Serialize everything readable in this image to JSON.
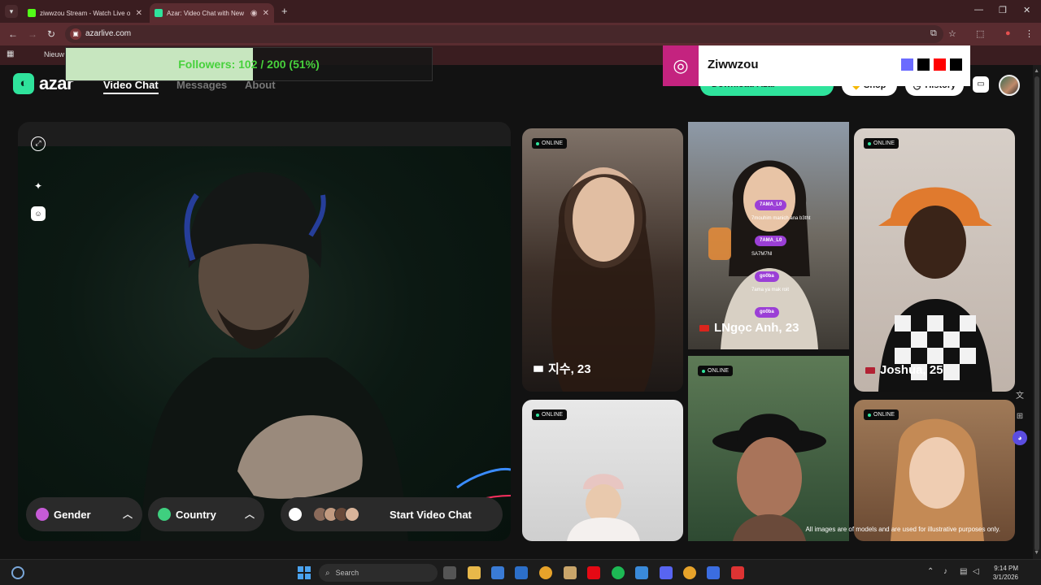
{
  "browser": {
    "tabs": [
      {
        "title": "ziwwzou Stream - Watch Live o",
        "favicon_color": "#53fc18"
      },
      {
        "title": "Azar: Video Chat with New",
        "favicon_color": "#2fe39c"
      }
    ],
    "new_tab": "+",
    "address": "azarlive.com",
    "bookmark": "Nieuw"
  },
  "overlay": {
    "followers_text": "Followers: 102 / 200 (51%)",
    "followers_progress": 0.51,
    "instagram_name": "Ziwwzou",
    "swatches": [
      "#6b6bff",
      "#000000",
      "#ff0000",
      "#000000"
    ]
  },
  "site": {
    "logo_text": "azar",
    "nav": [
      "Video Chat",
      "Messages",
      "About"
    ],
    "green_button": "Download Azar",
    "shop": "Shop",
    "history": "History"
  },
  "camera": {
    "filters": [
      {
        "label": "Gender",
        "icon": "gender-icon"
      },
      {
        "label": "Country",
        "icon": "globe-icon"
      }
    ],
    "start_label": "Start Video Chat"
  },
  "gallery": {
    "online_label": "ONLINE",
    "cards": [
      {
        "name": "지수, 23",
        "flag": "kr"
      },
      {
        "name": "LNgọc Anh, 23",
        "flag": "vn"
      },
      {
        "name": "Joshua, 25",
        "flag": "us"
      },
      {
        "name": "",
        "flag": ""
      },
      {
        "name": "",
        "flag": ""
      },
      {
        "name": "",
        "flag": ""
      }
    ],
    "disclaimer": "All images are of models and are used for illustrative purposes only."
  },
  "chat_overlay": [
    {
      "user": "7AMA_L0",
      "msg": "7mouhim manich ana b3tht"
    },
    {
      "user": "7AMA_L0",
      "msg": "SA7M7Nl"
    },
    {
      "user": "go0ba",
      "msg": "7ama ya mak roit"
    },
    {
      "user": "go0ba",
      "msg": ""
    }
  ],
  "taskbar": {
    "search_placeholder": "Search",
    "time": "9:14 PM",
    "date": "3/1/2026"
  }
}
